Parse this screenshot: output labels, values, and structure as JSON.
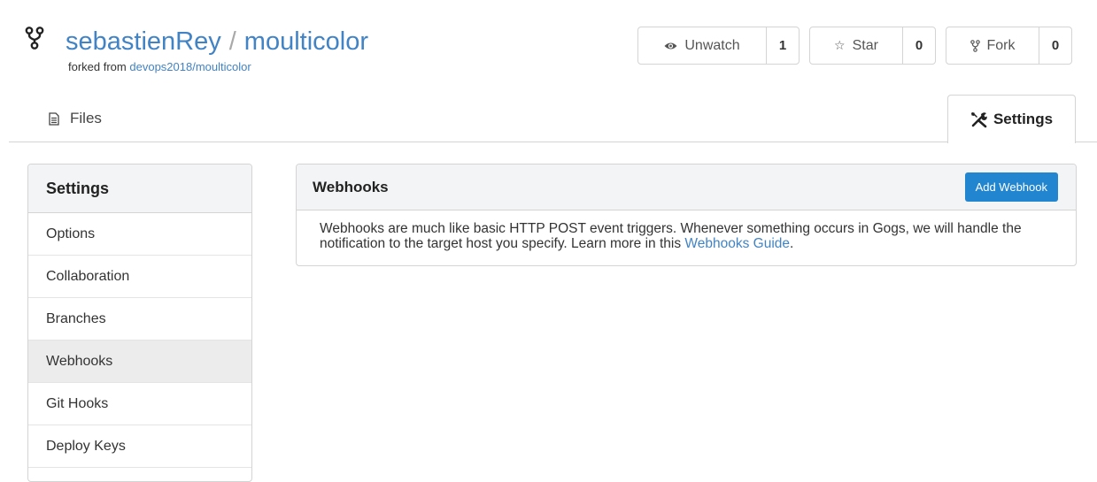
{
  "repo": {
    "owner": "sebastienRey",
    "separator": "/",
    "name": "moulticolor",
    "forked_from_prefix": "forked from",
    "forked_from_link": "devops2018/moulticolor"
  },
  "actions": {
    "watch": {
      "label": "Unwatch",
      "count": "1",
      "icon": "eye-icon"
    },
    "star": {
      "label": "Star",
      "count": "0",
      "icon": "star-icon"
    },
    "fork": {
      "label": "Fork",
      "count": "0",
      "icon": "fork-icon"
    }
  },
  "tabs": {
    "files": {
      "label": "Files",
      "icon": "file-text-icon"
    },
    "settings": {
      "label": "Settings",
      "icon": "tools-icon"
    }
  },
  "sidebar": {
    "title": "Settings",
    "items": [
      {
        "label": "Options"
      },
      {
        "label": "Collaboration"
      },
      {
        "label": "Branches"
      },
      {
        "label": "Webhooks",
        "active": true
      },
      {
        "label": "Git Hooks"
      },
      {
        "label": "Deploy Keys"
      }
    ]
  },
  "webhooks": {
    "title": "Webhooks",
    "add_button": "Add Webhook",
    "description": "Webhooks are much like basic HTTP POST event triggers. Whenever something occurs in Gogs, we will handle the notification to the target host you specify. Learn more in this",
    "guide_link": "Webhooks Guide",
    "trailing": "."
  },
  "colors": {
    "link": "#4183c4",
    "primary_button": "#2185d0",
    "active_item": "#ececec",
    "header_bg": "#f3f4f5"
  }
}
